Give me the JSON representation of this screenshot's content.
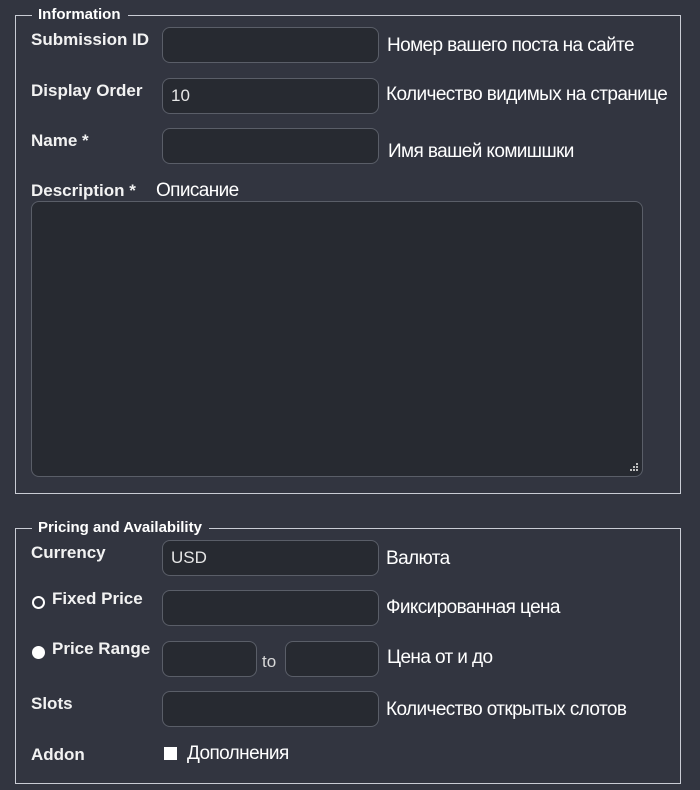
{
  "information": {
    "legend": "Information",
    "submission_id": {
      "label": "Submission ID",
      "value": "",
      "hint": "Номер вашего поста на сайте"
    },
    "display_order": {
      "label": "Display Order",
      "value": "10",
      "hint": "Количество видимых на странице"
    },
    "name": {
      "label": "Name *",
      "value": "",
      "hint": "Имя вашей комишшки"
    },
    "description": {
      "label": "Description *",
      "value": "",
      "hint": "Описание"
    }
  },
  "pricing": {
    "legend": "Pricing and Availability",
    "currency": {
      "label": "Currency",
      "value": "USD",
      "hint": "Валюта"
    },
    "fixed_price": {
      "label": "Fixed Price",
      "value": "",
      "hint": "Фиксированная цена",
      "selected": false
    },
    "price_range": {
      "label": "Price Range",
      "from_value": "",
      "to_label": "to",
      "to_value": "",
      "hint": "Цена от и до",
      "selected": true
    },
    "slots": {
      "label": "Slots",
      "value": "",
      "hint": "Количество открытых слотов"
    },
    "addon": {
      "label": "Addon",
      "hint": "Дополнения",
      "checked": true
    }
  },
  "colors": {
    "background": "#323540",
    "input_background": "#272a31",
    "border": "#c9ccd4"
  }
}
